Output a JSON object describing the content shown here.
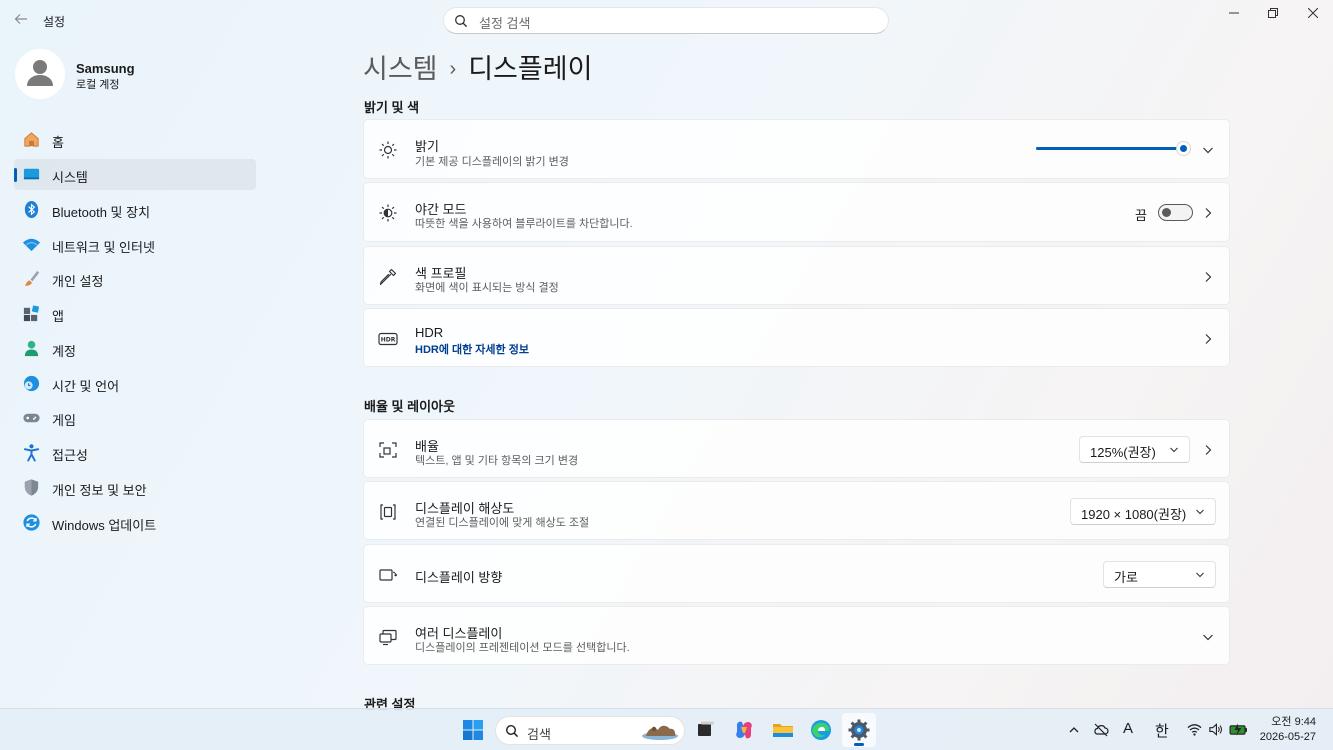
{
  "window": {
    "app_title": "설정",
    "search_placeholder": "설정 검색",
    "controls": [
      "minimize",
      "restore",
      "close"
    ]
  },
  "profile": {
    "name": "Samsung",
    "account_type": "로컬 계정"
  },
  "sidebar": {
    "items": [
      {
        "label": "홈",
        "icon": "home-icon",
        "active": false
      },
      {
        "label": "시스템",
        "icon": "system-icon",
        "active": true
      },
      {
        "label": "Bluetooth 및 장치",
        "icon": "bluetooth-icon",
        "active": false
      },
      {
        "label": "네트워크 및 인터넷",
        "icon": "network-icon",
        "active": false
      },
      {
        "label": "개인 설정",
        "icon": "brush-icon",
        "active": false
      },
      {
        "label": "앱",
        "icon": "apps-icon",
        "active": false
      },
      {
        "label": "계정",
        "icon": "account-icon",
        "active": false
      },
      {
        "label": "시간 및 언어",
        "icon": "time-language-icon",
        "active": false
      },
      {
        "label": "게임",
        "icon": "gaming-icon",
        "active": false
      },
      {
        "label": "접근성",
        "icon": "accessibility-icon",
        "active": false
      },
      {
        "label": "개인 정보 및 보안",
        "icon": "shield-icon",
        "active": false
      },
      {
        "label": "Windows 업데이트",
        "icon": "update-icon",
        "active": false
      }
    ]
  },
  "breadcrumb": {
    "parent": "시스템",
    "separator": "›",
    "current": "디스플레이"
  },
  "sections": {
    "brightness_color": {
      "title": "밝기 및 색",
      "brightness": {
        "title": "밝기",
        "subtitle": "기본 제공 디스플레이의 밝기 변경",
        "level_percent": 100
      },
      "night_light": {
        "title": "야간 모드",
        "subtitle": "따뜻한 색을 사용하여 블루라이트를 차단합니다.",
        "state_label": "끔",
        "on": false
      },
      "color_profile": {
        "title": "색 프로필",
        "subtitle": "화면에 색이 표시되는 방식 결정"
      },
      "hdr": {
        "title": "HDR",
        "link": "HDR에 대한 자세한 정보"
      }
    },
    "scale_layout": {
      "title": "배율 및 레이아웃",
      "scale": {
        "title": "배율",
        "subtitle": "텍스트, 앱 및 기타 항목의 크기 변경",
        "value": "125%(권장)"
      },
      "resolution": {
        "title": "디스플레이 해상도",
        "subtitle": "연결된 디스플레이에 맞게 해상도 조절",
        "value": "1920 × 1080(권장)"
      },
      "orientation": {
        "title": "디스플레이 방향",
        "value": "가로"
      },
      "multiple": {
        "title": "여러 디스플레이",
        "subtitle": "디스플레이의 프레젠테이션 모드를 선택합니다."
      }
    },
    "related": {
      "title": "관련 설정"
    }
  },
  "taskbar": {
    "search_label": "검색",
    "tray": {
      "ime_mode": "A",
      "ime_lang": "한"
    },
    "clock": {
      "time": "오전 9:44",
      "date": "2026-05-27"
    }
  },
  "colors": {
    "accent": "#005fb8",
    "link": "#003e92"
  }
}
